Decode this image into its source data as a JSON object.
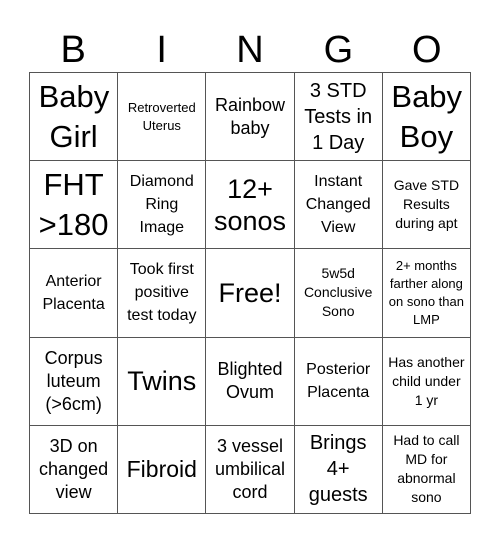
{
  "header": {
    "letters": [
      "B",
      "I",
      "N",
      "G",
      "O"
    ]
  },
  "card": {
    "rows": [
      [
        "Baby Girl",
        "Retroverted Uterus",
        "Rainbow baby",
        "3 STD Tests in 1 Day",
        "Baby Boy"
      ],
      [
        "FHT >180",
        "Diamond Ring Image",
        "12+ sonos",
        "Instant Changed View",
        "Gave STD Results during apt"
      ],
      [
        "Anterior Placenta",
        "Took first positive test today",
        "Free!",
        "5w5d Conclusive Sono",
        "2+ months farther along on sono than LMP"
      ],
      [
        "Corpus luteum (>6cm)",
        "Twins",
        "Blighted Ovum",
        "Posterior Placenta",
        "Has another child under 1 yr"
      ],
      [
        "3D on changed view",
        "Fibroid",
        "3 vessel umbilical cord",
        "Brings 4+ guests",
        "Had to call MD for abnormal sono"
      ]
    ]
  }
}
